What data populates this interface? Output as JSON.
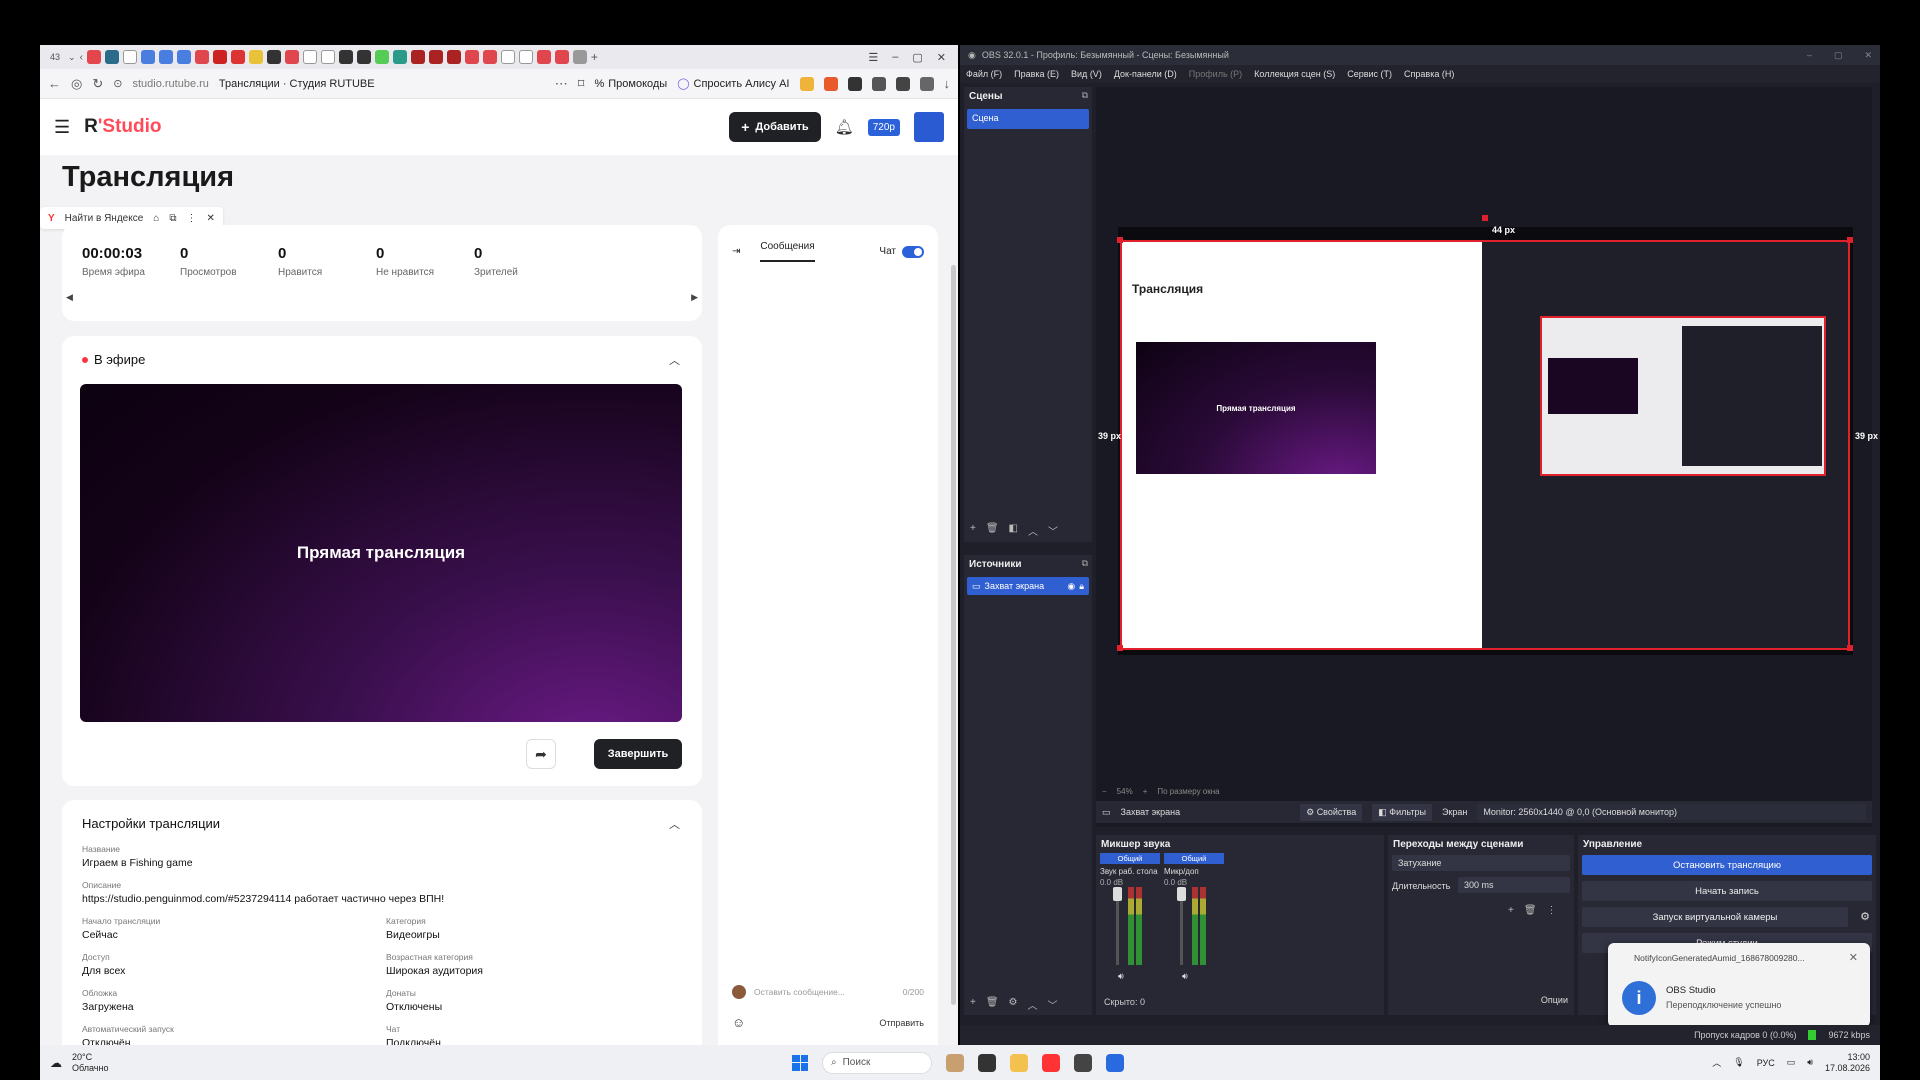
{
  "browser": {
    "tab_count": "43",
    "domain": "studio.rutube.ru",
    "page_title": "Трансляции · Студия RUTUBE",
    "promo_label": "Промокоды",
    "alice_label": "Спросить Алису AI"
  },
  "app": {
    "logo_r": "R",
    "logo_apostrophe": "'",
    "logo_studio": "Studio",
    "add_button": "Добавить",
    "quality": "720p"
  },
  "page": {
    "title": "Трансляция",
    "yandex_search": "Найти в Яндексе"
  },
  "stats": [
    {
      "value": "00:00:03",
      "label": "Время эфира"
    },
    {
      "value": "0",
      "label": "Просмотров"
    },
    {
      "value": "0",
      "label": "Нравится"
    },
    {
      "value": "0",
      "label": "Не нравится"
    },
    {
      "value": "0",
      "label": "Зрителей"
    }
  ],
  "live": {
    "header": "В эфире",
    "player_text": "Прямая трансляция",
    "end_button": "Завершить"
  },
  "settings": {
    "title": "Настройки трансляции",
    "name_label": "Название",
    "name_value": "Играем в Fishing game",
    "desc_label": "Описание",
    "desc_value": "https://studio.penguinmod.com/#5237294114 работает частично через ВПН!",
    "start_label": "Начало трансляции",
    "start_value": "Сейчас",
    "category_label": "Категория",
    "category_value": "Видеоигры",
    "access_label": "Доступ",
    "access_value": "Для всех",
    "age_label": "Возрастная категория",
    "age_value": "Широкая аудитория",
    "cover_label": "Обложка",
    "cover_value": "Загружена",
    "donate_label": "Донаты",
    "donate_value": "Отключены",
    "autostart_label": "Автоматический запуск",
    "autostart_value": "Отключён",
    "chat_label": "Чат",
    "chat_value": "Подключён"
  },
  "chat": {
    "tab_messages": "Сообщения",
    "chat_label": "Чат",
    "input_placeholder": "Оставить сообщение...",
    "counter": "0/200",
    "send": "Отправить"
  },
  "obs": {
    "title": "OBS 32.0.1 - Профиль: Безымянный - Сцены: Безымянный",
    "menu": [
      "Файл (F)",
      "Правка (E)",
      "Вид (V)",
      "Док-панели (D)",
      "Профиль (P)",
      "Коллекция сцен (S)",
      "Сервис (T)",
      "Справка (H)"
    ],
    "scenes_title": "Сцены",
    "scene_item": "Сцена",
    "sources_title": "Источники",
    "source_item": "Захват экрана",
    "dim_top": "44 px",
    "dim_left": "39 px",
    "dim_right": "39 px",
    "nested_player_text": "Прямая трансляция",
    "nested_title": "Трансляция",
    "zoom": "54%",
    "zoom_mode": "По размеру окна",
    "source_name": "Захват экрана",
    "properties": "Свойства",
    "filters": "Фильтры",
    "screen_label": "Экран",
    "monitor": "Monitor: 2560x1440 @ 0,0 (Основной монитор)",
    "mixer_title": "Микшер звука",
    "mixer_ch1_tag": "Общий",
    "mixer_ch1_name": "Звук раб. стола",
    "mixer_ch1_db": "0.0 dB",
    "mixer_ch2_tag": "Общий",
    "mixer_ch2_name": "Микр/доп",
    "mixer_ch2_db": "0.0 dB",
    "hidden_count": "Скрыто: 0",
    "transitions_title": "Переходы между сценами",
    "transition_type": "Затухание",
    "duration_label": "Длительность",
    "duration_value": "300 ms",
    "options": "Опции",
    "controls_title": "Управление",
    "stop_stream": "Остановить трансляцию",
    "start_record": "Начать запись",
    "virtual_cam": "Запуск виртуальной камеры",
    "studio_mode": "Режим студии",
    "dropped_frames": "Пропуск кадров 0 (0.0%)",
    "bitrate": "9672 kbps"
  },
  "toast": {
    "app_id": "NotifyIconGeneratedAumid_168678009280...",
    "title": "OBS Studio",
    "body": "Переподключение успешно"
  },
  "taskbar": {
    "temp": "20°C",
    "weather": "Облачно",
    "search": "Поиск",
    "lang": "РУС",
    "time": "13:00",
    "date": "17.08.2026"
  }
}
